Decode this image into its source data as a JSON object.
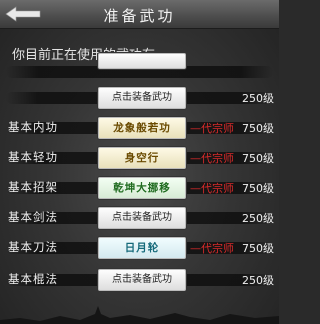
{
  "header": {
    "title": "准备武功",
    "back_icon": "back-arrow-icon"
  },
  "subtitle": "你目前正在使用的武功有:",
  "rows": [
    {
      "label": "",
      "button": "",
      "master": "",
      "level": ""
    },
    {
      "label": "",
      "button": "点击装备武功",
      "master": "",
      "level": "250级"
    },
    {
      "label": "基本内功",
      "button": "龙象般若功",
      "master": "—代宗师",
      "level": "750级"
    },
    {
      "label": "基本轻功",
      "button": "身空行",
      "master": "—代宗师",
      "level": "750级"
    },
    {
      "label": "基本招架",
      "button": "乾坤大挪移",
      "master": "—代宗师",
      "level": "750级"
    },
    {
      "label": "基本剑法",
      "button": "点击装备武功",
      "master": "",
      "level": "250级"
    },
    {
      "label": "基本刀法",
      "button": "日月轮",
      "master": "—代宗师",
      "level": "750级"
    },
    {
      "label": "基本棍法",
      "button": "点击装备武功",
      "master": "",
      "level": "250级"
    }
  ],
  "colors": {
    "master_red": "#d82a2a",
    "equipped_yellow": "#6a4a00",
    "equipped_green": "#1f6b1f",
    "equipped_teal": "#166a7a"
  }
}
